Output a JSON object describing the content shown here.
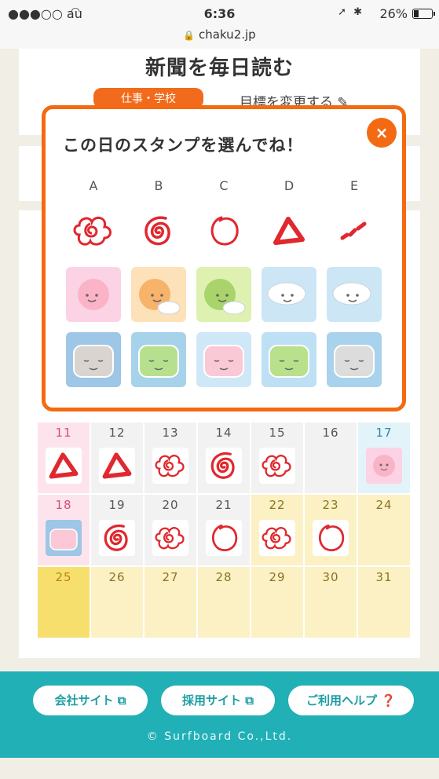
{
  "status_bar": {
    "carrier": "●●●○○ au",
    "time": "6:36",
    "battery": "26%"
  },
  "browser": {
    "url": "chaku2.jp"
  },
  "goal": {
    "title": "新聞を毎日読む",
    "category": "仕事・学校",
    "edit_label": "目標を変更する"
  },
  "modal": {
    "title": "この日のスタンプを選んでね！",
    "close_label": "×",
    "columns": [
      "A",
      "B",
      "C",
      "D",
      "E"
    ],
    "red_stamp_icons": [
      "flower-swirl-stamp-icon",
      "double-circle-stamp-icon",
      "circle-stamp-icon",
      "triangle-stamp-icon",
      "dots-stamp-icon"
    ],
    "weather_icons": [
      "sunny-face-icon",
      "sun-cloud-face-icon",
      "green-sun-cloud-face-icon",
      "cloud-face-icon",
      "sad-cloud-face-icon"
    ],
    "pillow_icons": [
      "sleeping-pillow-icon",
      "green-pillow-icon",
      "pink-pillow-icon",
      "sweat-pillow-icon",
      "worried-pillow-icon"
    ]
  },
  "calendar": {
    "rows": [
      [
        {
          "day": "11",
          "stamp": "triangle"
        },
        {
          "day": "12",
          "stamp": "triangle"
        },
        {
          "day": "13",
          "stamp": "swirl"
        },
        {
          "day": "14",
          "stamp": "double"
        },
        {
          "day": "15",
          "stamp": "swirl"
        },
        {
          "day": "16",
          "stamp": ""
        },
        {
          "day": "17",
          "stamp": "sun"
        }
      ],
      [
        {
          "day": "18",
          "stamp": "pillow"
        },
        {
          "day": "19",
          "stamp": "double"
        },
        {
          "day": "20",
          "stamp": "swirl"
        },
        {
          "day": "21",
          "stamp": "circle"
        },
        {
          "day": "22",
          "stamp": "swirl"
        },
        {
          "day": "23",
          "stamp": "circle"
        },
        {
          "day": "24",
          "stamp": ""
        }
      ],
      [
        {
          "day": "25",
          "stamp": ""
        },
        {
          "day": "26",
          "stamp": ""
        },
        {
          "day": "27",
          "stamp": ""
        },
        {
          "day": "28",
          "stamp": ""
        },
        {
          "day": "29",
          "stamp": ""
        },
        {
          "day": "30",
          "stamp": ""
        },
        {
          "day": "31",
          "stamp": ""
        }
      ]
    ]
  },
  "footer": {
    "company_site": "会社サイト",
    "recruit_site": "採用サイト",
    "help": "ご利用ヘルプ",
    "copyright": "© Surfboard Co.,Ltd."
  },
  "colors": {
    "accent": "#f36a12",
    "footer": "#21b0b6",
    "stamp_red": "#e0282e"
  }
}
